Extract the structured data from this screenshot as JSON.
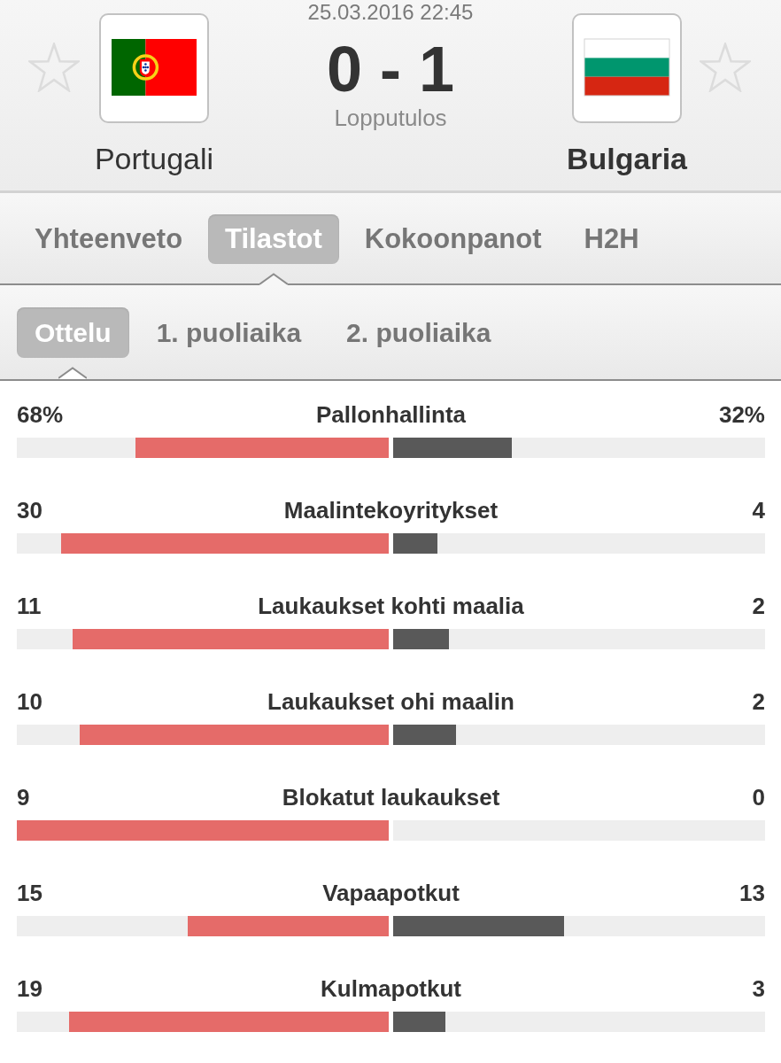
{
  "match": {
    "datetime": "25.03.2016 22:45",
    "score": "0 - 1",
    "status": "Lopputulos"
  },
  "teams": [
    {
      "kind": "portugal",
      "name": "Portugali",
      "favorite": false,
      "winner": false
    },
    {
      "kind": "bulgaria",
      "name": "Bulgaria",
      "favorite": false,
      "winner": true
    }
  ],
  "tabs": [
    {
      "label": "Yhteenveto",
      "selected": false
    },
    {
      "label": "Tilastot",
      "selected": true
    },
    {
      "label": "Kokoonpanot",
      "selected": false
    },
    {
      "label": "H2H",
      "selected": false
    }
  ],
  "subtabs": [
    {
      "label": "Ottelu",
      "selected": true
    },
    {
      "label": "1. puoliaika",
      "selected": false
    },
    {
      "label": "2. puoliaika",
      "selected": false
    }
  ],
  "stats": [
    {
      "label": "Pallonhallinta",
      "home": {
        "value": "68%",
        "level": 0.68
      },
      "away": {
        "value": "32%",
        "level": 0.32
      }
    },
    {
      "label": "Maalintekoyritykset",
      "home": {
        "value": "30",
        "level": 0.88
      },
      "away": {
        "value": "4",
        "level": 0.12
      }
    },
    {
      "label": "Laukaukset kohti maalia",
      "home": {
        "value": "11",
        "level": 0.85
      },
      "away": {
        "value": "2",
        "level": 0.15
      }
    },
    {
      "label": "Laukaukset ohi maalin",
      "home": {
        "value": "10",
        "level": 0.83
      },
      "away": {
        "value": "2",
        "level": 0.17
      }
    },
    {
      "label": "Blokatut laukaukset",
      "home": {
        "value": "9",
        "level": 1
      },
      "away": {
        "value": "0"
      }
    },
    {
      "label": "Vapaapotkut",
      "home": {
        "value": "15",
        "level": 0.54
      },
      "away": {
        "value": "13",
        "level": 0.46
      }
    },
    {
      "label": "Kulmapotkut",
      "home": {
        "value": "19",
        "level": 0.86
      },
      "away": {
        "value": "3",
        "level": 0.14
      }
    }
  ]
}
